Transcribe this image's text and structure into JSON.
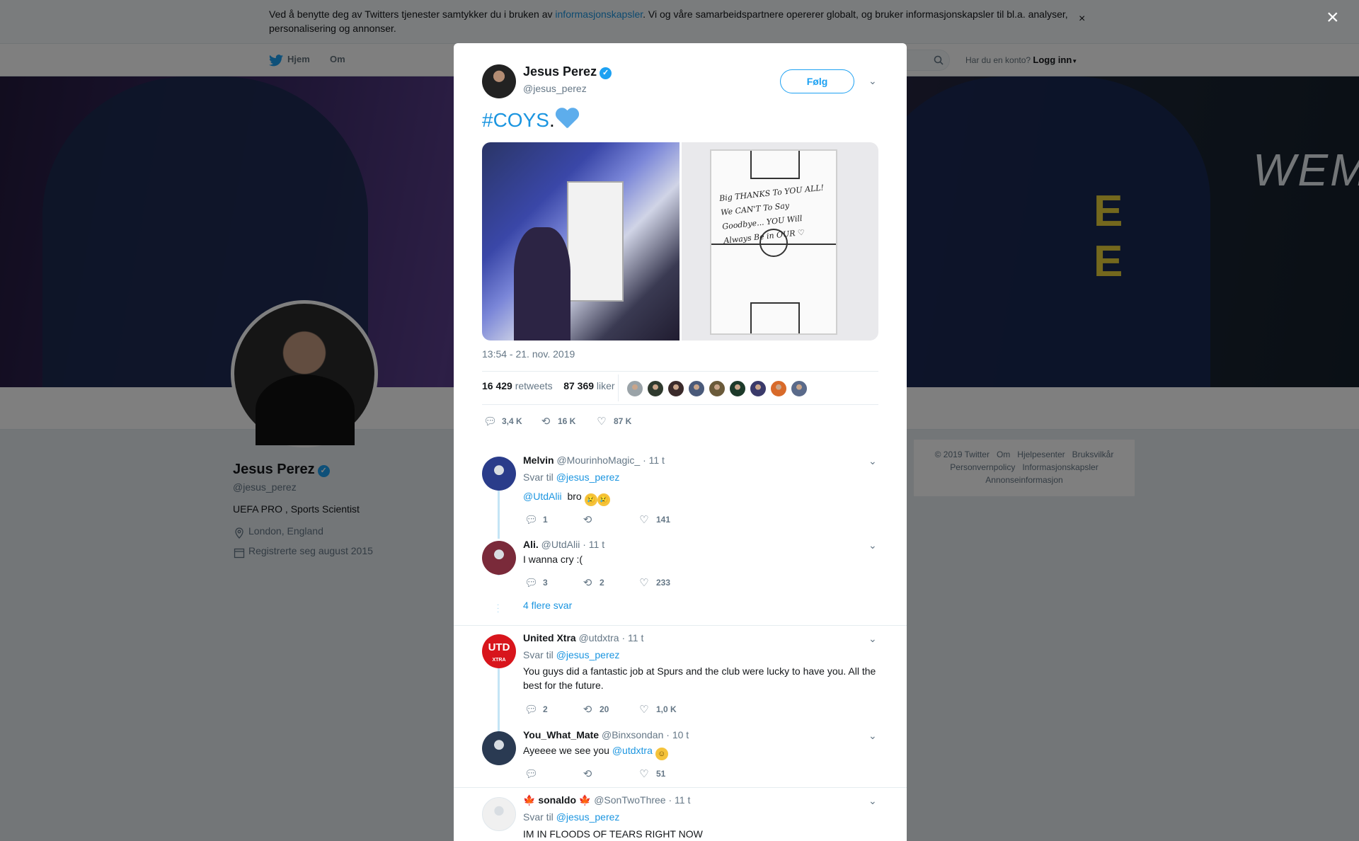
{
  "cookie": {
    "text_before": "Ved å benytte deg av Twitters tjenester samtykker du i bruken av ",
    "link": "informasjonskapsler",
    "text_after": ". Vi og våre samarbeidspartnere opererer globalt, og bruker informasjonskapsler til bl.a. analyser, personalisering og annonser.",
    "close": "×"
  },
  "nav": {
    "home": "Hjem",
    "about": "Om",
    "login_question": "Har du en konto?",
    "login": "Logg inn"
  },
  "profile": {
    "name": "Jesus Perez",
    "handle": "@jesus_perez",
    "bio": "UEFA PRO , Sports Scientist",
    "location": "London, England",
    "joined": "Registrerte seg august 2015"
  },
  "footer": {
    "row1": [
      "© 2019 Twitter",
      "Om",
      "Hjelpesenter",
      "Bruksvilkår"
    ],
    "row2": [
      "Personvernpolicy",
      "Informasjonskapsler"
    ],
    "row3": [
      "Annonseinformasjon"
    ]
  },
  "modal": {
    "close": "×",
    "author_name": "Jesus Perez",
    "author_handle": "@jesus_perez",
    "follow": "Følg",
    "hashtag": "#COYS",
    "text_after": ".",
    "board_text": "Big THANKS To YOU ALL! We CAN'T To Say Goodbye... YOU Will Always Be in OUR ♡",
    "timestamp": "13:54 - 21. nov. 2019",
    "retweets_count": "16 429",
    "retweets_label": "retweets",
    "likes_count": "87 369",
    "likes_label": "liker",
    "actions": {
      "replies": "3,4 K",
      "retweets": "16 K",
      "likes": "87 K"
    },
    "liker_colors": [
      "#9aa3a8",
      "#2f3a2e",
      "#3a2a2a",
      "#4a5a7a",
      "#6a5a3a",
      "#1d3a2a",
      "#3a3a6a",
      "#d86a2a",
      "#5a6a8a"
    ]
  },
  "replies": [
    {
      "name": "Melvin",
      "handle": "@MourinhoMagic_",
      "time": "· 11 t",
      "to_label": "Svar til",
      "to": "@jesus_perez",
      "mention": "@UtdAlii",
      "text": "bro",
      "emojis": [
        "😢",
        "😢"
      ],
      "counts": {
        "replies": "1",
        "retweets": "",
        "likes": "141"
      },
      "avatar_color": "#2a3c8a"
    },
    {
      "name": "Ali.",
      "handle": "@UtdAlii",
      "time": "· 11 t",
      "text": "I wanna cry :(",
      "counts": {
        "replies": "3",
        "retweets": "2",
        "likes": "233"
      },
      "avatar_color": "#7a2a3a"
    },
    {
      "more": "4 flere svar"
    },
    {
      "name": "United Xtra",
      "handle": "@utdxtra",
      "time": "· 11 t",
      "to_label": "Svar til",
      "to": "@jesus_perez",
      "text": "You guys did a fantastic job at Spurs and the club were lucky to have you. All the best for the future.",
      "counts": {
        "replies": "2",
        "retweets": "20",
        "likes": "1,0 K"
      },
      "avatar_color": "#d8151c",
      "avatar_text": "UTD",
      "avatar_subtext": "XTRA"
    },
    {
      "name": "You_What_Mate",
      "handle": "@Binxsondan",
      "time": "· 10 t",
      "text": "Ayeeee we see you",
      "mention": "@utdxtra",
      "counts": {
        "replies": "",
        "retweets": "",
        "likes": "51"
      },
      "avatar_color": "#2a3a52"
    },
    {
      "name": "sonaldo",
      "name_flag": "🍁",
      "handle": "@SonTwoThree",
      "time": "· 11 t",
      "to_label": "Svar til",
      "to": "@jesus_perez",
      "text": "IM IN FLOODS OF TEARS RIGHT NOW",
      "avatar_color": "#f0f0f0"
    }
  ]
}
